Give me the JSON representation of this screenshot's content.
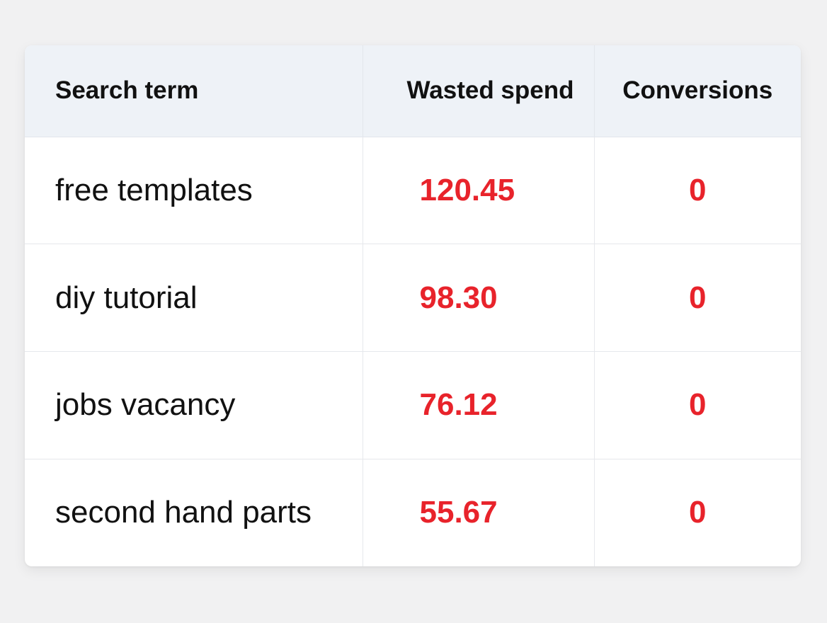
{
  "table": {
    "headers": {
      "term": "Search term",
      "spend": "Wasted spend",
      "conversions": "Conversions"
    },
    "rows": [
      {
        "term": "free templates",
        "spend": "120.45",
        "conversions": "0"
      },
      {
        "term": "diy tutorial",
        "spend": "98.30",
        "conversions": "0"
      },
      {
        "term": "jobs vacancy",
        "spend": "76.12",
        "conversions": "0"
      },
      {
        "term": "second hand parts",
        "spend": "55.67",
        "conversions": "0"
      }
    ]
  },
  "colors": {
    "header_background": "#eef2f7",
    "highlight_text": "#e8232b",
    "page_background": "#f1f1f2"
  }
}
